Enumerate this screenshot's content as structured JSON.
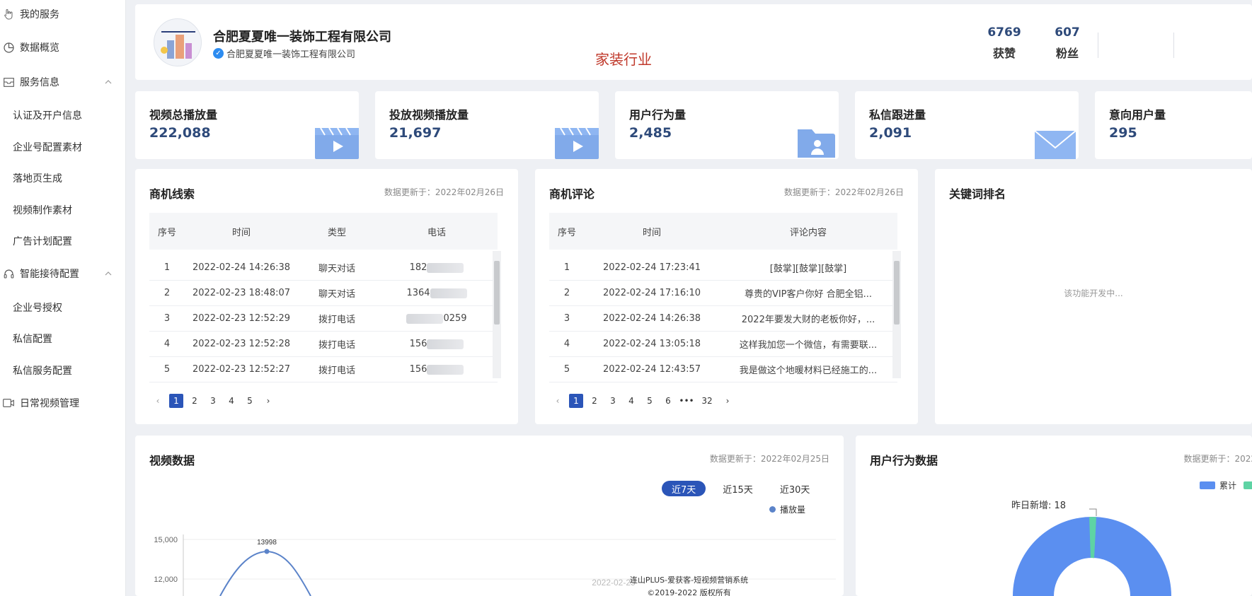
{
  "sidebar": {
    "items": [
      {
        "label": "我的服务",
        "icon": "hand-pointer-icon"
      },
      {
        "label": "数据概览",
        "icon": "pie-chart-icon"
      },
      {
        "label": "服务信息",
        "icon": "mail-box-icon"
      },
      {
        "label": "认证及开户信息"
      },
      {
        "label": "企业号配置素材"
      },
      {
        "label": "落地页生成"
      },
      {
        "label": "视频制作素材"
      },
      {
        "label": "广告计划配置"
      },
      {
        "label": "智能接待配置",
        "icon": "headset-icon"
      },
      {
        "label": "企业号授权"
      },
      {
        "label": "私信配置"
      },
      {
        "label": "私信服务配置"
      },
      {
        "label": "日常视频管理",
        "icon": "video-icon"
      }
    ]
  },
  "profile": {
    "name": "合肥夏夏唯一装饰工程有限公司",
    "verified_name": "合肥夏夏唯一装饰工程有限公司",
    "industry": "家装行业",
    "stats": [
      {
        "value": "6769",
        "label": "获赞"
      },
      {
        "value": "607",
        "label": "粉丝"
      }
    ]
  },
  "metrics": [
    {
      "title": "视频总播放量",
      "value": "222,088",
      "icon": "video-play-icon"
    },
    {
      "title": "投放视频播放量",
      "value": "21,697",
      "icon": "video-play-icon"
    },
    {
      "title": "用户行为量",
      "value": "2,485",
      "icon": "user-folder-icon"
    },
    {
      "title": "私信跟进量",
      "value": "2,091",
      "icon": "envelope-icon"
    },
    {
      "title": "意向用户量",
      "value": "295"
    }
  ],
  "leads": {
    "title": "商机线索",
    "updated": "数据更新于：2022年02月26日",
    "headers": [
      "序号",
      "时间",
      "类型",
      "电话"
    ],
    "rows": [
      {
        "no": "1",
        "time": "2022-02-24 14:26:38",
        "type": "聊天对话",
        "phone": "182"
      },
      {
        "no": "2",
        "time": "2022-02-23 18:48:07",
        "type": "聊天对话",
        "phone": "1364"
      },
      {
        "no": "3",
        "time": "2022-02-23 12:52:29",
        "type": "拨打电话",
        "phone": "0259"
      },
      {
        "no": "4",
        "time": "2022-02-23 12:52:28",
        "type": "拨打电话",
        "phone": "156"
      },
      {
        "no": "5",
        "time": "2022-02-23 12:52:27",
        "type": "拨打电话",
        "phone": "156"
      }
    ],
    "pages": [
      "1",
      "2",
      "3",
      "4",
      "5"
    ],
    "current_page": "1"
  },
  "comments": {
    "title": "商机评论",
    "updated": "数据更新于：2022年02月26日",
    "headers": [
      "序号",
      "时间",
      "评论内容"
    ],
    "rows": [
      {
        "no": "1",
        "time": "2022-02-24 17:23:41",
        "content": "[鼓掌][鼓掌][鼓掌]"
      },
      {
        "no": "2",
        "time": "2022-02-24 17:16:10",
        "content": "尊贵的VIP客户你好 合肥全铝..."
      },
      {
        "no": "3",
        "time": "2022-02-24 14:26:38",
        "content": "2022年要发大财的老板你好，..."
      },
      {
        "no": "4",
        "time": "2022-02-24 13:05:18",
        "content": "这样我加您一个微信，有需要联..."
      },
      {
        "no": "5",
        "time": "2022-02-24 12:43:57",
        "content": "我是做这个地暖材料已经施工的..."
      }
    ],
    "pages": [
      "1",
      "2",
      "3",
      "4",
      "5",
      "6",
      "•••",
      "32"
    ],
    "current_page": "1"
  },
  "keywords": {
    "title": "关键词排名",
    "note": "该功能开发中..."
  },
  "video_data": {
    "title": "视频数据",
    "updated": "数据更新于：2022年02月25日",
    "ranges": [
      "近7天",
      "近15天",
      "近30天"
    ],
    "active_range": "近7天",
    "legend": "播放量",
    "peak_label": "13998",
    "tooltip_date": "2022-02-25"
  },
  "behavior_data": {
    "title": "用户行为数据",
    "updated": "数据更新于：2022",
    "legend": [
      "累计"
    ],
    "annotation": "昨日新增: 18"
  },
  "chart_data": {
    "type": "line",
    "series": [
      {
        "name": "播放量",
        "peak": 13998
      }
    ],
    "y_ticks": [
      "15,000",
      "12,000"
    ],
    "ylim": [
      12000,
      15000
    ]
  },
  "footer": {
    "line1": "连山PLUS-爱获客-短视频营销系统",
    "line2": "©2019-2022 版权所有"
  },
  "colors": {
    "accent": "#2b55b8",
    "value": "#2e4a7a",
    "industry": "#c0392b",
    "donut_blue": "#5b8ff0",
    "donut_green": "#5ed3a4"
  }
}
